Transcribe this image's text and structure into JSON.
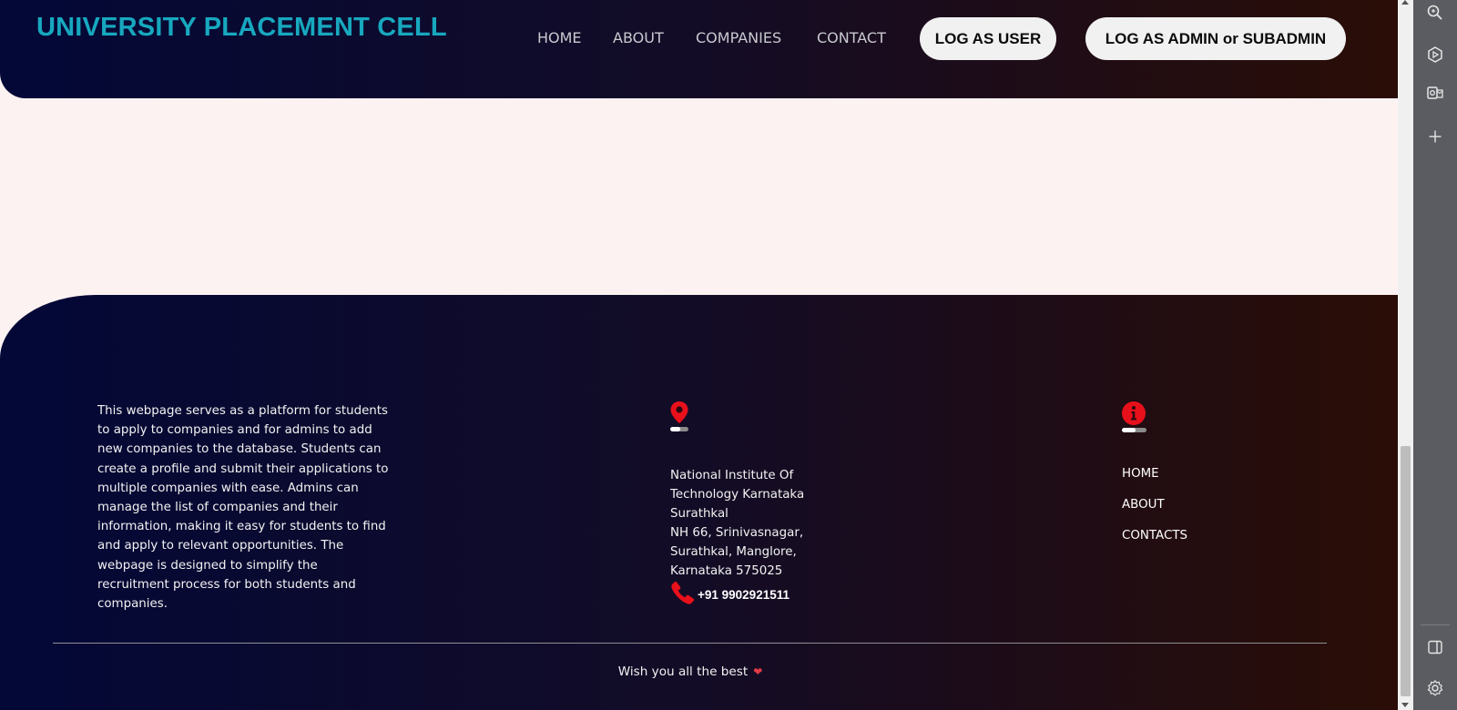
{
  "header": {
    "brand": "UNIVERSITY PLACEMENT CELL",
    "nav": [
      "HOME",
      "ABOUT",
      "COMPANIES",
      "CONTACT"
    ],
    "buttons": {
      "user": "LOG AS USER",
      "admin": "LOG AS ADMIN or SUBADMIN"
    }
  },
  "footer": {
    "about": "This webpage serves as a platform for students to apply to companies and for admins to add new companies to the database. Students can create a profile and submit their applications to multiple companies with ease. Admins can manage the list of companies and their information, making it easy for students to find and apply to relevant opportunities. The webpage is designed to simplify the recruitment process for both students and companies.",
    "address_lines": [
      "National Institute Of",
      "Technology Karnataka",
      "Surathkal",
      "NH 66, Srinivasnagar,",
      "Surathkal, Manglore,",
      "Karnataka 575025"
    ],
    "phone": "+91 9902921511",
    "links": [
      "HOME",
      "ABOUT",
      "CONTACTS"
    ],
    "wish": "Wish you all the best",
    "icons": {
      "location": "location-pin-icon",
      "info": "info-icon",
      "phone": "phone-icon",
      "heart": "heart-icon"
    }
  },
  "colors": {
    "brand": "#17a8bf",
    "accent_red": "#e8101a",
    "page_bg": "#fdf2f2"
  }
}
